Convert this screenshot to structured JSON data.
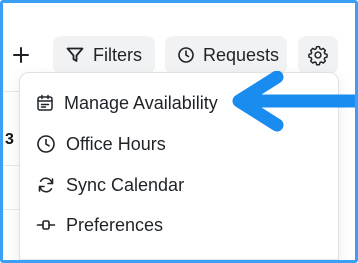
{
  "toolbar": {
    "add_icon": "plus-icon",
    "filters": {
      "label": "Filters",
      "icon": "filter-icon"
    },
    "requests": {
      "label": "Requests",
      "icon": "clock-icon"
    },
    "settings": {
      "icon": "gear-icon"
    }
  },
  "background": {
    "partial_value": "3"
  },
  "menu": {
    "items": [
      {
        "label": "Manage Availability",
        "icon": "calendar-icon"
      },
      {
        "label": "Office Hours",
        "icon": "clock-icon"
      },
      {
        "label": "Sync Calendar",
        "icon": "sync-icon"
      },
      {
        "label": "Preferences",
        "icon": "slider-icon"
      }
    ]
  },
  "annotation": {
    "arrow_color": "#1a8cf0"
  },
  "colors": {
    "frame_border": "#3aa0f5",
    "button_bg": "#f1f2f4"
  }
}
